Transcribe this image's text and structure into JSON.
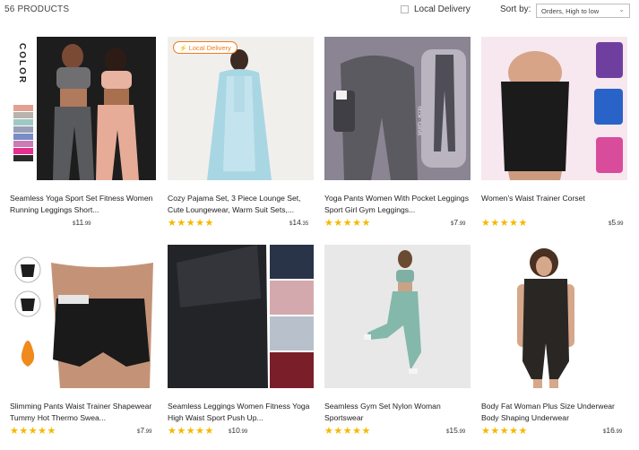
{
  "header": {
    "product_count": "56 PRODUCTS",
    "local_delivery_label": "Local Delivery",
    "sort_label": "Sort by:",
    "sort_value": "Orders, High to low"
  },
  "colors": {
    "star": "#f5b800",
    "badge": "#f07b1c"
  },
  "products": [
    {
      "title": "Seamless Yoga Sport Set Fitness Women Running Leggings Short...",
      "price_currency": "$",
      "price_whole": "11",
      "price_cents": ".99",
      "rating": 0,
      "badge": "",
      "image_label": "COLOR"
    },
    {
      "title": "Cozy Pajama Set, 3 Piece Lounge Set, Cute Loungewear, Warm Suit Sets,...",
      "price_currency": "$",
      "price_whole": "14",
      "price_cents": ".35",
      "rating": 5,
      "badge": "Local Delivery",
      "image_label": ""
    },
    {
      "title": "Yoga Pants Women With Pocket Leggings Sport Girl Gym Leggings...",
      "price_currency": "$",
      "price_whole": "7",
      "price_cents": ".99",
      "rating": 5,
      "badge": "",
      "image_label": "SPORTS · ACCES"
    },
    {
      "title": "Women's Waist Trainer Corset",
      "price_currency": "$",
      "price_whole": "5",
      "price_cents": ".99",
      "rating": 5,
      "badge": "",
      "image_label": ""
    },
    {
      "title": "Slimming Pants Waist Trainer Shapewear Tummy Hot Thermo Swea...",
      "price_currency": "$",
      "price_whole": "7",
      "price_cents": ".99",
      "rating": 5,
      "badge": "",
      "image_label": ""
    },
    {
      "title": "Seamless Leggings Women Fitness Yoga High Waist Sport Push Up...",
      "price_currency": "$",
      "price_whole": "10",
      "price_cents": ".99",
      "rating": 5,
      "badge": "",
      "image_label": ""
    },
    {
      "title": "Seamless Gym Set Nylon Woman Sportswear",
      "price_currency": "$",
      "price_whole": "15",
      "price_cents": ".99",
      "rating": 5,
      "badge": "",
      "image_label": ""
    },
    {
      "title": "Body Fat Woman Plus Size Underwear Body Shaping Underwear",
      "price_currency": "$",
      "price_whole": "16",
      "price_cents": ".99",
      "rating": 5,
      "badge": "",
      "image_label": ""
    }
  ]
}
